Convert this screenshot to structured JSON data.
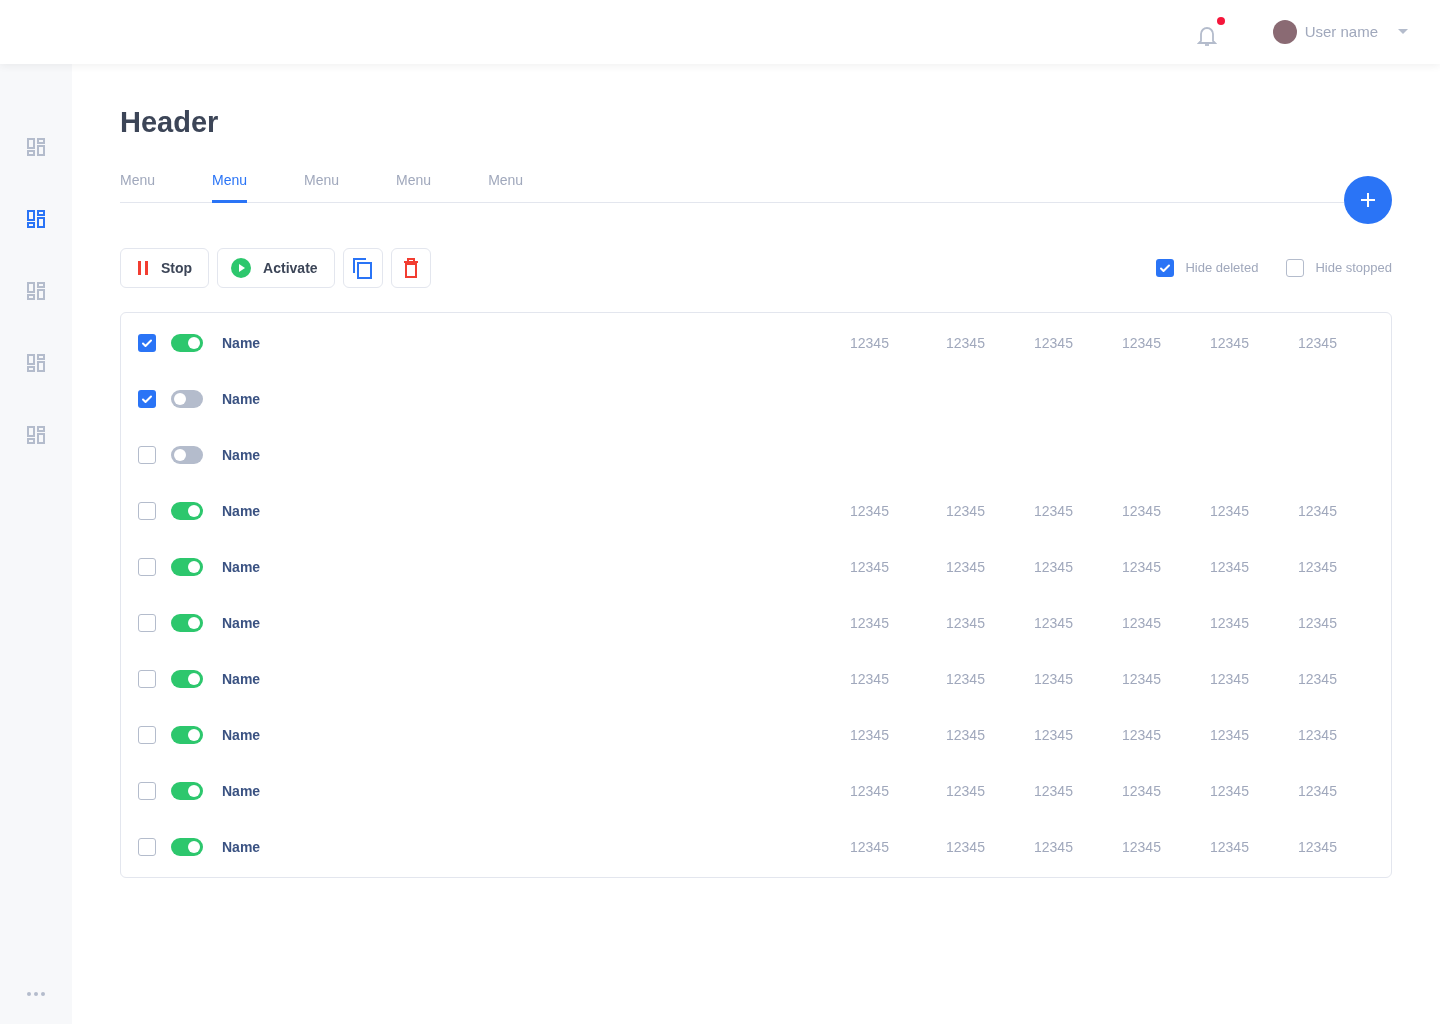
{
  "topbar": {
    "unread": true,
    "user_name": "User name"
  },
  "sidebar": {
    "items": [
      {
        "selected": false
      },
      {
        "selected": true
      },
      {
        "selected": false
      },
      {
        "selected": false
      },
      {
        "selected": false
      }
    ]
  },
  "header": "Header",
  "tabs": [
    {
      "label": "Menu",
      "selected": false
    },
    {
      "label": "Menu",
      "selected": true
    },
    {
      "label": "Menu",
      "selected": false
    },
    {
      "label": "Menu",
      "selected": false
    },
    {
      "label": "Menu",
      "selected": false
    }
  ],
  "toolbar": {
    "stop_label": "Stop",
    "activate_label": "Activate"
  },
  "filters": [
    {
      "label": "Hide deleted",
      "checked": true
    },
    {
      "label": "Hide stopped",
      "checked": false
    }
  ],
  "rows": [
    {
      "checked": true,
      "on": true,
      "name": "Name",
      "values": [
        "12345",
        "12345",
        "12345",
        "12345",
        "12345",
        "12345"
      ]
    },
    {
      "checked": true,
      "on": false,
      "name": "Name",
      "values": []
    },
    {
      "checked": false,
      "on": false,
      "name": "Name",
      "values": []
    },
    {
      "checked": false,
      "on": true,
      "name": "Name",
      "values": [
        "12345",
        "12345",
        "12345",
        "12345",
        "12345",
        "12345"
      ]
    },
    {
      "checked": false,
      "on": true,
      "name": "Name",
      "values": [
        "12345",
        "12345",
        "12345",
        "12345",
        "12345",
        "12345"
      ]
    },
    {
      "checked": false,
      "on": true,
      "name": "Name",
      "values": [
        "12345",
        "12345",
        "12345",
        "12345",
        "12345",
        "12345"
      ]
    },
    {
      "checked": false,
      "on": true,
      "name": "Name",
      "values": [
        "12345",
        "12345",
        "12345",
        "12345",
        "12345",
        "12345"
      ]
    },
    {
      "checked": false,
      "on": true,
      "name": "Name",
      "values": [
        "12345",
        "12345",
        "12345",
        "12345",
        "12345",
        "12345"
      ]
    },
    {
      "checked": false,
      "on": true,
      "name": "Name",
      "values": [
        "12345",
        "12345",
        "12345",
        "12345",
        "12345",
        "12345"
      ]
    },
    {
      "checked": false,
      "on": true,
      "name": "Name",
      "values": [
        "12345",
        "12345",
        "12345",
        "12345",
        "12345",
        "12345"
      ]
    }
  ]
}
